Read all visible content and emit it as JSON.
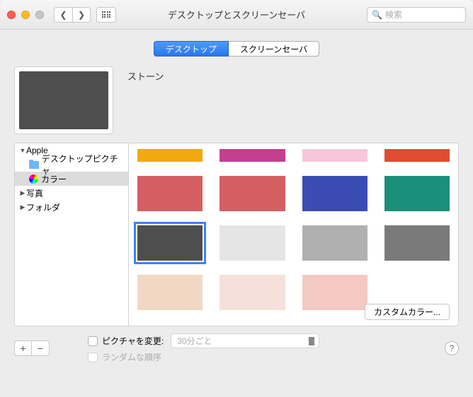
{
  "window": {
    "title": "デスクトップとスクリーンセーバ",
    "search_placeholder": "検索"
  },
  "tabs": {
    "desktop": "デスクトップ",
    "screensaver": "スクリーンセーバ"
  },
  "preview": {
    "label": "ストーン"
  },
  "sidebar": {
    "apple": "Apple",
    "desktop_pictures": "デスクトップピクチャ",
    "colors": "カラー",
    "photos": "写真",
    "folders": "フォルダ"
  },
  "swatches": [
    {
      "color": "#f1a90e",
      "clipped": true
    },
    {
      "color": "#c33f8f",
      "clipped": true
    },
    {
      "color": "#f7c7d9",
      "clipped": true
    },
    {
      "color": "#e04c30",
      "clipped": true
    },
    {
      "color": "#d45f62"
    },
    {
      "color": "#d45f62"
    },
    {
      "color": "#3a4bb3"
    },
    {
      "color": "#1a8f7a"
    },
    {
      "color": "#4e4e4e",
      "selected": true
    },
    {
      "color": "#e5e5e5"
    },
    {
      "color": "#b0b0b0"
    },
    {
      "color": "#7a7a7a"
    },
    {
      "color": "#f2d8c4"
    },
    {
      "color": "#f5e1d9"
    },
    {
      "color": "#f3c9c2"
    }
  ],
  "buttons": {
    "custom_color": "カスタムカラー..."
  },
  "options": {
    "change_picture": "ピクチャを変更:",
    "interval": "30分ごと",
    "random": "ランダムな順序"
  }
}
